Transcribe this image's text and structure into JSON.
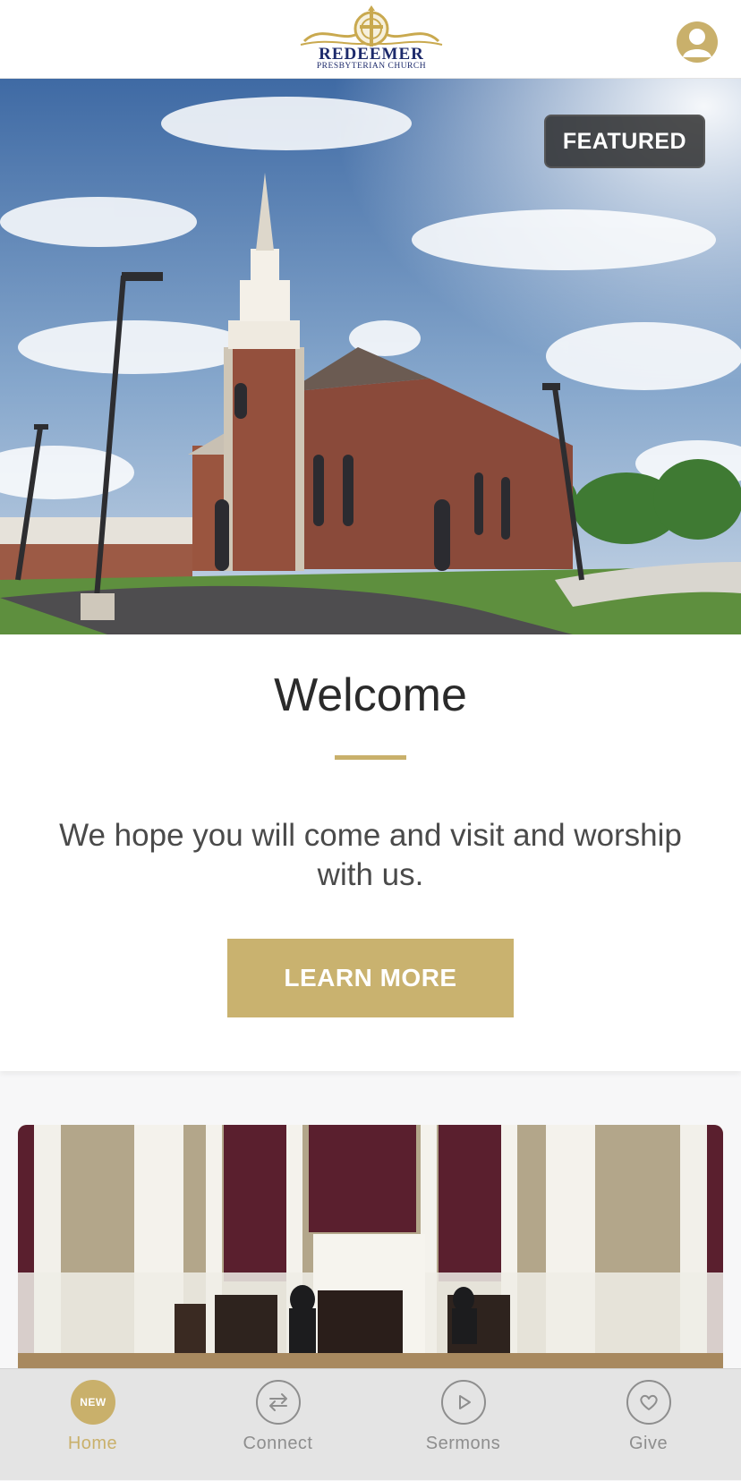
{
  "header": {
    "logo_title": "REDEEMER",
    "logo_subtitle": "PRESBYTERIAN CHURCH",
    "brand_color": "#c9b06b",
    "logo_text_color": "#1d2a6b",
    "profile_icon": "user-profile-icon"
  },
  "hero": {
    "badge": "FEATURED",
    "image": "brick church with white steeple under cloudy blue sky"
  },
  "welcome": {
    "title": "Welcome",
    "body": "We hope you will come and visit and worship with us.",
    "button": "LEARN MORE",
    "accent": "#c9b26f"
  },
  "second_card": {
    "image": "church sanctuary interior with pulpit and chairs"
  },
  "tabbar": {
    "active_color": "#c9b06b",
    "inactive_color": "#8e8e8e",
    "tabs": [
      {
        "label": "Home",
        "badge": "NEW",
        "icon": "new-badge-icon",
        "active": true
      },
      {
        "label": "Connect",
        "icon": "connect-arrows-icon",
        "active": false
      },
      {
        "label": "Sermons",
        "icon": "play-icon",
        "active": false
      },
      {
        "label": "Give",
        "icon": "heart-icon",
        "active": false
      }
    ]
  }
}
